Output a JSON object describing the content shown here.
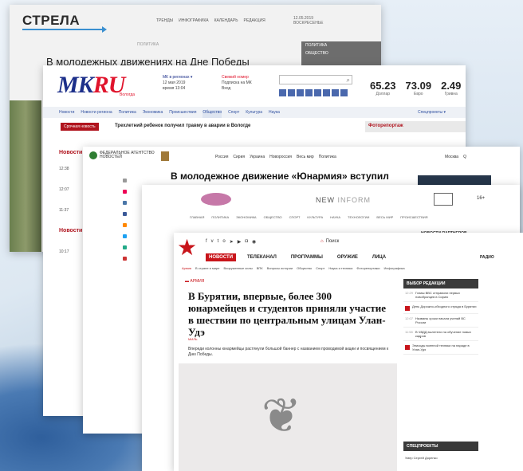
{
  "strela": {
    "logo": "СТРЕЛА",
    "nav": [
      "ТРЕНДЫ",
      "ИНФОГРАФИКА",
      "КАЛЕНДАРЬ",
      "РЕДАКЦИЯ"
    ],
    "date_line1": "12.05.2019",
    "date_line2": "ВОСКРЕСЕНЬЕ",
    "rubric": "ПОЛИТИКА",
    "headline": "В молодежных движениях на Дне Победы",
    "side_items": [
      "ПОЛИТИКА",
      "ОБЩЕСТВО"
    ]
  },
  "mk": {
    "logo_main": "MK",
    "logo_red": "RU",
    "logo_sub": "Вологда",
    "col1_title": "МК в регионах ▾",
    "col1_date": "12 мая 2019",
    "col1_time": "время 13:04",
    "col2_title": "Свежий номер",
    "col2_sub": "Подписка на МК",
    "col2_login": "Вход",
    "rates": [
      {
        "value": "65.23",
        "label": "Доллар"
      },
      {
        "value": "73.09",
        "label": "Евро"
      },
      {
        "value": "2.49",
        "label": "Гривна"
      }
    ],
    "nav": [
      "Новости",
      "Новости региона",
      "Политика",
      "Экономика",
      "Происшествия",
      "Общество",
      "Спорт",
      "Культура",
      "Наука"
    ],
    "active_nav": "Общество",
    "specprojects": "Спецпроекты ▾",
    "urgent_label": "Срочная новость",
    "urgent_text": "Трехлетний ребенок получил травму в аварии в Вологде",
    "photoreport": "Фоторепортаж",
    "news_label": "Новости",
    "news_label2": "Новости",
    "times": [
      "12:38",
      "12:07",
      "11:37",
      "10:17"
    ]
  },
  "fan": {
    "logo": "ФЕДЕРАЛЬНОЕ АГЕНТСТВО НОВОСТЕЙ",
    "nav": [
      "Россия",
      "Сирия",
      "Украина",
      "Новороссия",
      "Весь мир",
      "Политика"
    ],
    "right": [
      "Москва",
      "Q"
    ],
    "headline": "В молодежное движение «Юнармия» вступил"
  },
  "newinform": {
    "brand_a": "NEW",
    "brand_b": "INFORM",
    "age": "16+",
    "nav": [
      "ГЛАВНАЯ",
      "ПОЛИТИКА",
      "ЭКОНОМИКА",
      "ОБЩЕСТВО",
      "СПОРТ",
      "КУЛЬТУРА",
      "НАУКА",
      "ТЕХНОЛОГИИ",
      "ВЕСЬ МИР",
      "ПРОИСШЕСТВИЯ"
    ],
    "partners": "НОВОСТИ ПАРТНЕРОВ"
  },
  "zvezda": {
    "search": "Поиск",
    "nav": [
      "НОВОСТИ",
      "ТЕЛЕКАНАЛ",
      "ПРОГРАММЫ",
      "ОРУЖИЕ",
      "ЛИЦА"
    ],
    "radio": "РАДИО",
    "sub": [
      "Армия",
      "В стране и мире",
      "Вооруженные силы",
      "ВПК",
      "Вопросы истории",
      "Общество",
      "Спорт",
      "Наука и техника",
      "Фоторепортажи",
      "Инфографика"
    ],
    "section": "АРМИЯ",
    "title": "В Бурятии, впервые, более 300 юнармейцев и студентов приняли участие в шествии по центральным улицам Улан-Удэ",
    "meta": "МИЛЬ",
    "lead": "Впереди колонны юнармейцы растянули большой баннер с названием проводимой акции и посвящением к Дню Победы.",
    "feed_title": "ВЫБОР РЕДАКЦИИ",
    "feed": [
      {
        "t": "12:29",
        "d": "Главы ВВС отправили первых новобранцев в Сирию"
      },
      {
        "t": "12:18",
        "d": "День Дорожно-обходного отряда в Бурятии"
      },
      {
        "t": "12:07",
        "d": "Названы сроки начала учений ВС России"
      },
      {
        "t": "11:58",
        "d": "В ЧВДД вылетели на обучение новых кадров"
      },
      {
        "t": "11:42",
        "d": "Эпизоды военной техники на параде в Улан-Удэ"
      }
    ],
    "spec_title": "СПЕЦПРОЕКТЫ",
    "spec_item": "Умер Сергей Доренко"
  }
}
